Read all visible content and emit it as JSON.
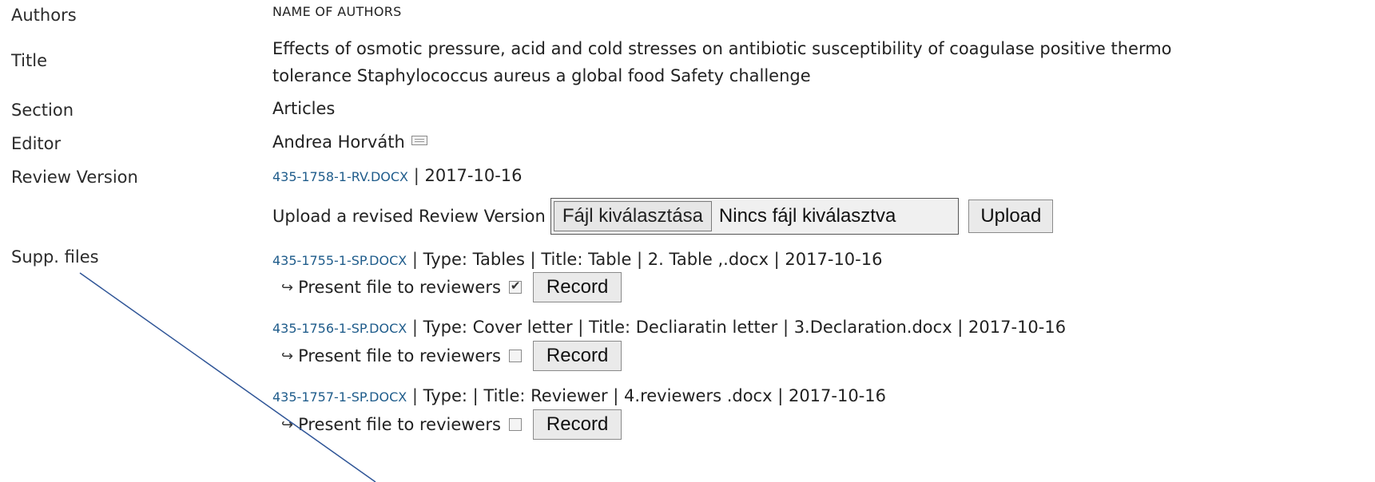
{
  "labels": {
    "authors": "Authors",
    "title": "Title",
    "section": "Section",
    "editor": "Editor",
    "review_version": "Review Version",
    "supp_files": "Supp. files"
  },
  "values": {
    "authors": "NAME OF AUTHORS",
    "title_line1": "Effects of osmotic pressure, acid and cold stresses on antibiotic susceptibility of coagulase positive thermo",
    "title_line2": "tolerance Staphylococcus aureus a global food Safety challenge",
    "section": "Articles",
    "editor": "Andrea Horváth",
    "editor_icon": "mail-icon",
    "review_file": "435-1758-1-RV.DOCX",
    "review_date": "2017-10-16"
  },
  "upload": {
    "label": "Upload a revised Review Version",
    "choose_button": "Fájl kiválasztása",
    "no_file": "Nincs fájl kiválasztva",
    "upload_button": "Upload"
  },
  "supp_files": [
    {
      "file": "435-1755-1-SP.DOCX",
      "details": "Type: Tables | Title: Table | 2. Table ,.docx | 2017-10-16",
      "present_label": "Present file to reviewers",
      "checked": true,
      "record_button": "Record"
    },
    {
      "file": "435-1756-1-SP.DOCX",
      "details": "Type: Cover letter | Title: Decliaratin letter | 3.Declaration.docx | 2017-10-16",
      "present_label": "Present file to reviewers",
      "checked": false,
      "record_button": "Record"
    },
    {
      "file": "435-1757-1-SP.DOCX",
      "details": "Type: | Title: Reviewer | 4.reviewers .docx | 2017-10-16",
      "present_label": "Present file to reviewers",
      "checked": false,
      "record_button": "Record"
    }
  ],
  "arrow_glyph": "↪",
  "colors": {
    "link": "#1f5c8b",
    "annotation_line": "#2f5597"
  }
}
